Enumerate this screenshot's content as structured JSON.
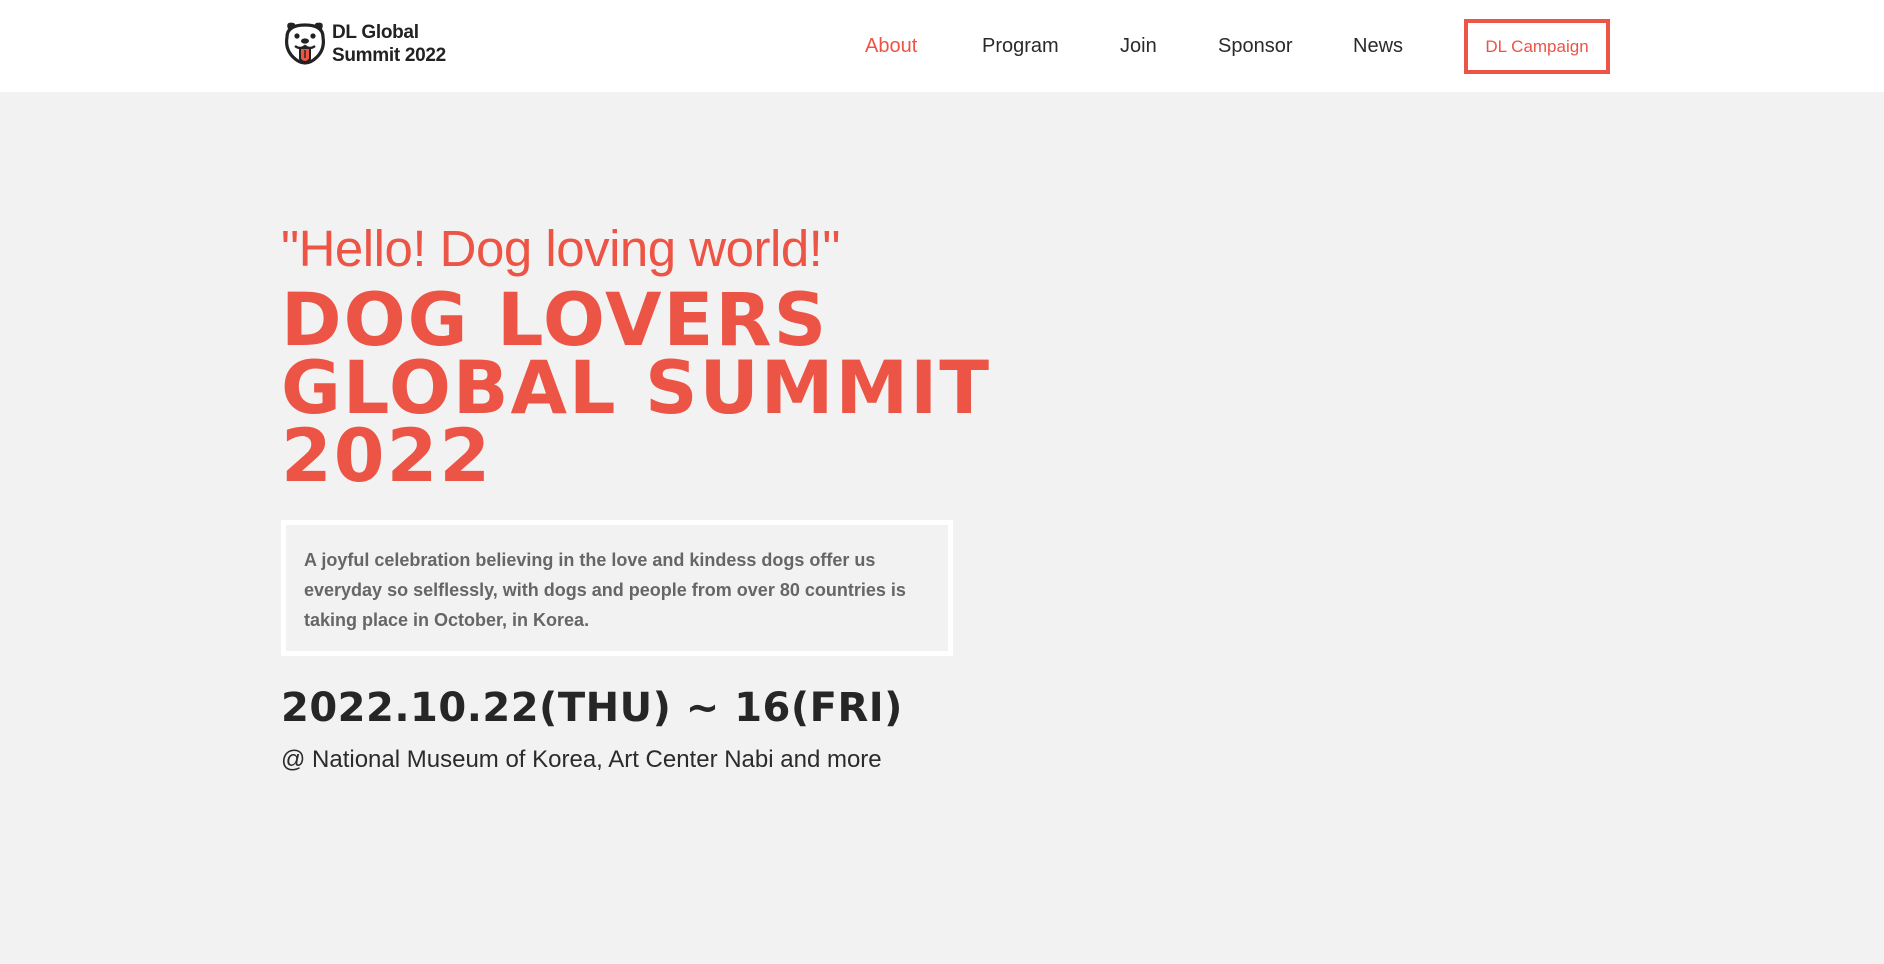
{
  "header": {
    "logo_line1": "DL Global",
    "logo_line2": "Summit 2022",
    "nav": [
      {
        "label": "About",
        "active": true
      },
      {
        "label": "Program",
        "active": false
      },
      {
        "label": "Join",
        "active": false
      },
      {
        "label": "Sponsor",
        "active": false
      },
      {
        "label": "News",
        "active": false
      }
    ],
    "cta_label": "DL Campaign"
  },
  "hero": {
    "tagline": "\"Hello! Dog loving world!\"",
    "title_lines": [
      "DOG LOVERS",
      "GLOBAL SUMMIT",
      "2022"
    ],
    "description": "A joyful celebration believing in the love and kindess dogs offer us everyday so selflessly, with dogs and people from over 80 countries is taking place in October, in Korea.",
    "dates": "2022.10.22(THU) ~ 16(FRI)",
    "venue": "@ National Museum of Korea, Art Center Nabi and more"
  },
  "icons": {
    "logo": "dog-face-icon"
  },
  "colors": {
    "accent": "#ec5445",
    "background": "#f2f2f2",
    "header_bg": "#ffffff",
    "text_dark": "#262626",
    "text_muted": "#666666"
  }
}
